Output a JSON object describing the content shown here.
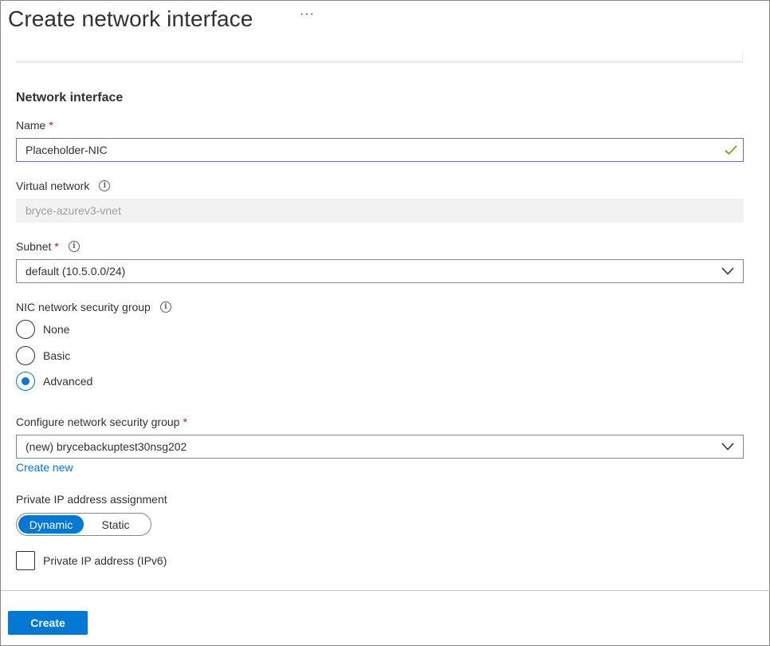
{
  "header": {
    "title": "Create network interface",
    "more_label": "···"
  },
  "section": {
    "title": "Network interface"
  },
  "name_field": {
    "label": "Name",
    "required_mark": "*",
    "value": "Placeholder-NIC"
  },
  "vnet_field": {
    "label": "Virtual network",
    "value": "bryce-azurev3-vnet"
  },
  "subnet_field": {
    "label": "Subnet",
    "required_mark": "*",
    "value": "default (10.5.0.0/24)"
  },
  "nsg_group": {
    "label": "NIC network security group",
    "options": [
      {
        "label": "None",
        "selected": false
      },
      {
        "label": "Basic",
        "selected": false
      },
      {
        "label": "Advanced",
        "selected": true
      }
    ]
  },
  "configure_nsg": {
    "label": "Configure network security group",
    "required_mark": "*",
    "value": "(new) brycebackuptest30nsg202",
    "create_new_label": "Create new"
  },
  "ip_assignment": {
    "label": "Private IP address assignment",
    "options": [
      "Dynamic",
      "Static"
    ],
    "selected": "Dynamic"
  },
  "ipv6": {
    "label": "Private IP address (IPv6)",
    "checked": false
  },
  "footer": {
    "create_label": "Create"
  },
  "colors": {
    "accent": "#0078d4",
    "valid_border": "#8764b8",
    "valid_check": "#57a300",
    "required": "#a4262c"
  },
  "icons": {
    "more": "ellipsis-icon",
    "info": "info-icon",
    "valid": "checkmark-icon",
    "dropdown": "chevron-down-icon"
  }
}
